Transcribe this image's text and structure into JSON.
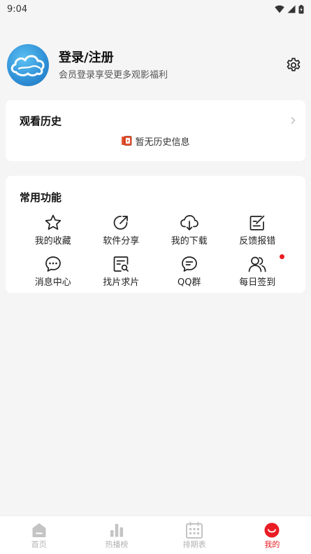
{
  "status_bar": {
    "time": "9:04"
  },
  "profile": {
    "title": "登录/注册",
    "subtitle": "会员登录享受更多观影福利"
  },
  "history": {
    "title": "观看历史",
    "empty_text": "暂无历史信息"
  },
  "features": {
    "title": "常用功能",
    "items": [
      {
        "label": "我的收藏",
        "icon": "star-icon"
      },
      {
        "label": "软件分享",
        "icon": "share-icon"
      },
      {
        "label": "我的下载",
        "icon": "cloud-download-icon"
      },
      {
        "label": "反馈报错",
        "icon": "edit-icon"
      },
      {
        "label": "消息中心",
        "icon": "message-icon"
      },
      {
        "label": "找片求片",
        "icon": "search-document-icon"
      },
      {
        "label": "QQ群",
        "icon": "chat-icon"
      },
      {
        "label": "每日签到",
        "icon": "users-icon"
      }
    ]
  },
  "bottom_nav": {
    "items": [
      {
        "label": "首页",
        "icon": "home-icon"
      },
      {
        "label": "热播榜",
        "icon": "bar-chart-icon"
      },
      {
        "label": "排期表",
        "icon": "calendar-icon"
      },
      {
        "label": "我的",
        "icon": "smile-icon"
      }
    ],
    "active_index": 3
  },
  "colors": {
    "accent": "#ea1c24",
    "background": "#f5f5f5",
    "card": "#ffffff",
    "inactive_nav": "#b3b3b3"
  }
}
